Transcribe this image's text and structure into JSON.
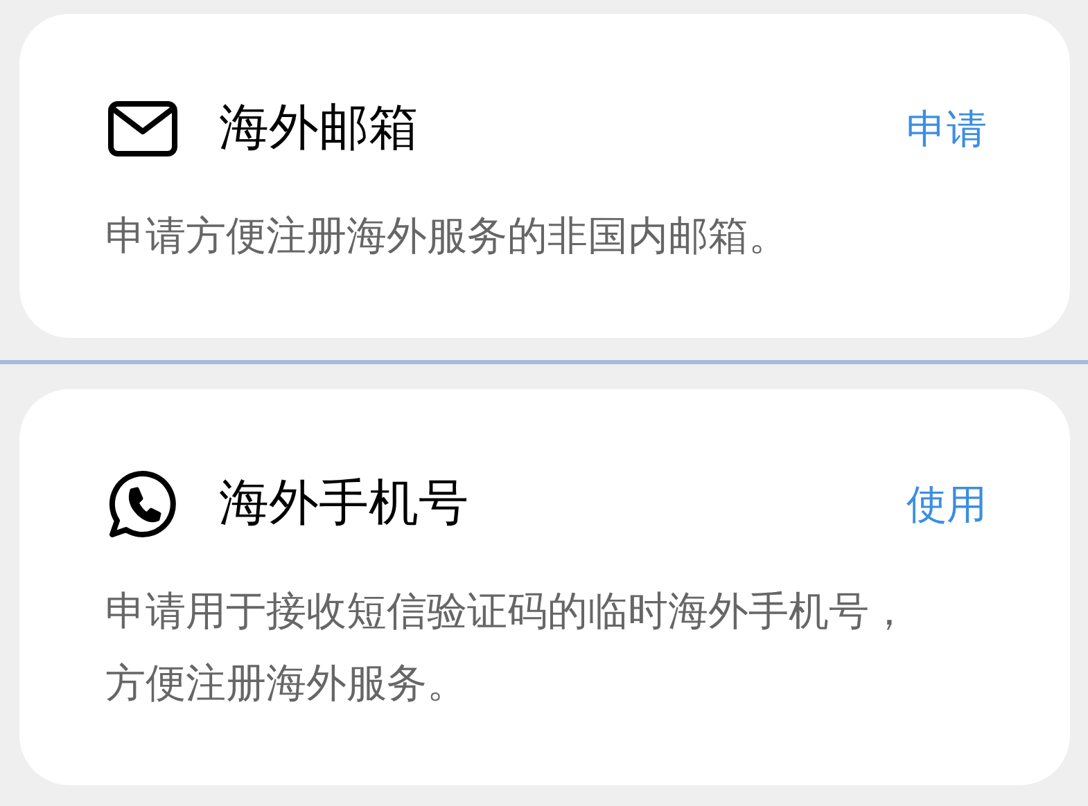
{
  "cards": [
    {
      "kind": "email",
      "title": "海外邮箱",
      "action": "申请",
      "description": "申请方便注册海外服务的非国内邮箱。"
    },
    {
      "kind": "phone",
      "title": "海外手机号",
      "action": "使用",
      "description": "申请用于接收短信验证码的临时海外手机号，方便注册海外服务。"
    }
  ]
}
